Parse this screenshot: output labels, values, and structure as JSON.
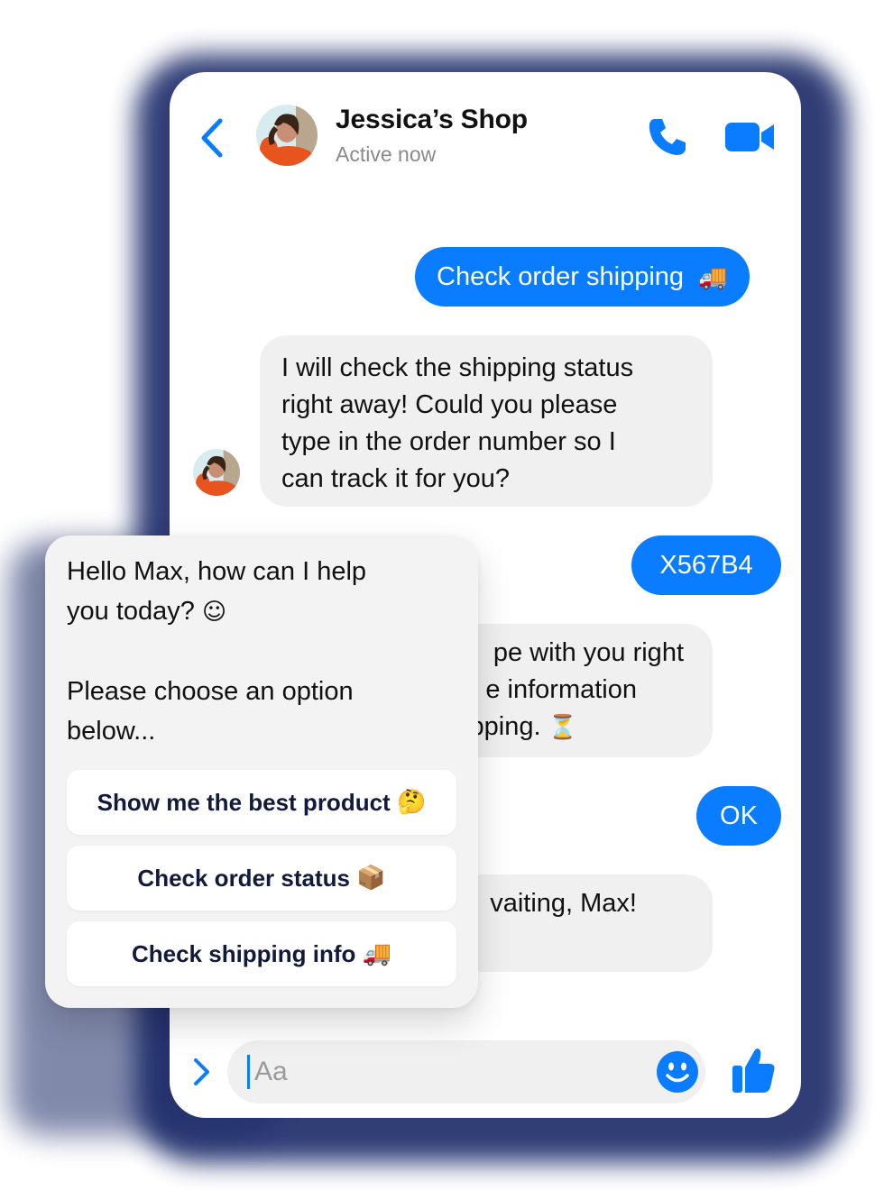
{
  "header": {
    "shop_name": "Jessica’s Shop",
    "status": "Active now"
  },
  "messages": [
    {
      "from": "user",
      "text": "Check order shipping",
      "emoji": "🚚"
    },
    {
      "from": "shop",
      "lines": [
        "I will check the shipping status",
        "right away! Could you please",
        "type in the order number so I",
        "can track it for you?"
      ]
    },
    {
      "from": "user",
      "text": "X567B4"
    },
    {
      "from": "shop",
      "lines": [
        "pe with you right",
        "e information",
        "pping."
      ],
      "emoji": "⏳"
    },
    {
      "from": "user",
      "text": "OK"
    },
    {
      "from": "shop",
      "lines": [
        "vaiting, Max!"
      ]
    }
  ],
  "composer": {
    "placeholder": "Aa"
  },
  "overlay": {
    "greeting_lines": [
      "Hello Max, how can I help",
      "you today?"
    ],
    "greeting_emoji": "☺",
    "prompt_lines": [
      "Please choose an option",
      "below..."
    ],
    "options": [
      {
        "label": "Show me the best product",
        "emoji": "🤔"
      },
      {
        "label": "Check order status",
        "emoji": "📦"
      },
      {
        "label": "Check shipping info",
        "emoji": "🚚"
      }
    ]
  },
  "colors": {
    "accent": "#0a7cff",
    "incoming_bubble": "#f0f0f0",
    "overlay_bg": "#f3f3f3"
  },
  "icons": [
    "back-icon",
    "phone-icon",
    "video-camera-icon",
    "chevron-right-icon",
    "smiley-icon",
    "thumbs-up-icon"
  ]
}
